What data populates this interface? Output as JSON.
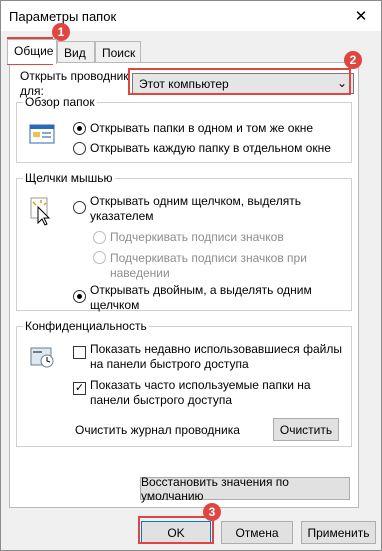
{
  "window": {
    "title": "Параметры папок",
    "close_glyph": "✕"
  },
  "tabs": [
    {
      "label": "Общие",
      "active": true
    },
    {
      "label": "Вид",
      "active": false
    },
    {
      "label": "Поиск",
      "active": false
    }
  ],
  "general": {
    "open_explorer_label": "Открыть проводник для:",
    "open_explorer_value": "Этот компьютер",
    "browse_group": {
      "legend": "Обзор папок",
      "options": [
        "Открывать папки в одном и том же окне",
        "Открывать каждую папку в отдельном окне"
      ],
      "selected": 0
    },
    "click_group": {
      "legend": "Щелчки мышью",
      "single_click": "Открывать одним щелчком, выделять указателем",
      "underline_always": "Подчеркивать подписи значков",
      "underline_hover": "Подчеркивать подписи значков при наведении",
      "double_click": "Открывать двойным, а выделять одним щелчком",
      "selected": "double"
    },
    "privacy_group": {
      "legend": "Конфиденциальность",
      "show_recent_files": "Показать недавно использовавшиеся файлы на панели быстрого доступа",
      "show_recent_files_checked": false,
      "show_frequent_folders": "Показать часто используемые папки на панели быстрого доступа",
      "show_frequent_folders_checked": true,
      "clear_history_label": "Очистить журнал проводника",
      "clear_button": "Очистить"
    },
    "restore_defaults_button": "Восстановить значения по умолчанию"
  },
  "footer": {
    "ok": "OK",
    "cancel": "Отмена",
    "apply": "Применить"
  },
  "annotations": {
    "markers": [
      "1",
      "2",
      "3"
    ],
    "color": "#e0463f"
  },
  "icons": [
    "close-icon",
    "dropdown-arrow-icon",
    "folder-window-icon",
    "mouse-click-icon",
    "privacy-icon"
  ]
}
